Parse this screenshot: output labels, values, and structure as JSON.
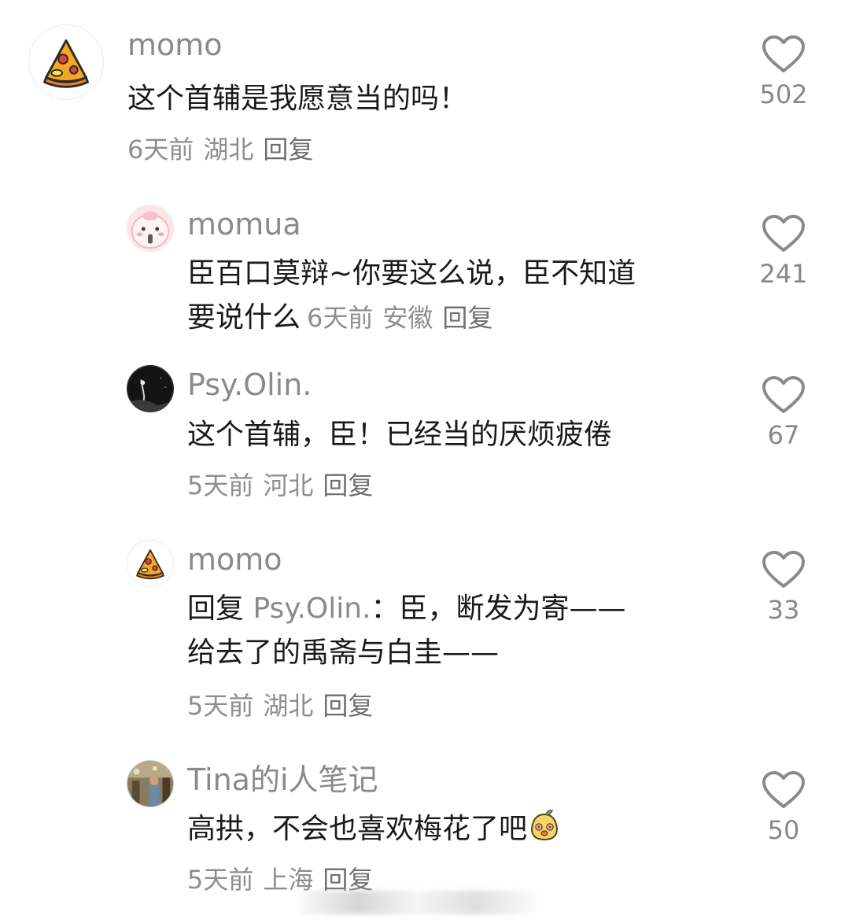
{
  "comments": [
    {
      "username": "momo",
      "text_lines": [
        "这个首辅是我愿意当的吗！"
      ],
      "time": "6天前",
      "location": "湖北",
      "reply_label": "回复",
      "likes": "502",
      "avatar_icon": "pizza-avatar"
    },
    {
      "username": "momua",
      "text_lines": [
        "臣百口莫辩~你要这么说，臣不知道",
        "要说什么"
      ],
      "time": "6天前",
      "location": "安徽",
      "reply_label": "回复",
      "likes": "241",
      "avatar_icon": "pink-cartoon-avatar"
    },
    {
      "username": "Psy.Olin.",
      "text_lines": [
        "这个首辅，臣！已经当的厌烦疲倦"
      ],
      "time": "5天前",
      "location": "河北",
      "reply_label": "回复",
      "likes": "67",
      "avatar_icon": "dark-photo-avatar"
    },
    {
      "username": "momo",
      "reply_prefix": "回复",
      "reply_to": "Psy.Olin.",
      "text_lines": [
        "：臣，断发为寄——",
        "给去了的禹斋与白圭——"
      ],
      "time": "5天前",
      "location": "湖北",
      "reply_label": "回复",
      "likes": "33",
      "avatar_icon": "pizza-avatar"
    },
    {
      "username": "Tina的i人笔记",
      "text_lines": [
        "高拱，不会也喜欢梅花了吧"
      ],
      "time": "5天前",
      "location": "上海",
      "reply_label": "回复",
      "likes": "50",
      "avatar_icon": "photo-avatar",
      "emoji_icon": "cartoon-face-emoji"
    }
  ],
  "colors": {
    "username": "#8a8a8a",
    "body_text": "#1a1a1a",
    "meta_text": "#8e8e8e",
    "heart_outline": "#8a8a8a"
  }
}
